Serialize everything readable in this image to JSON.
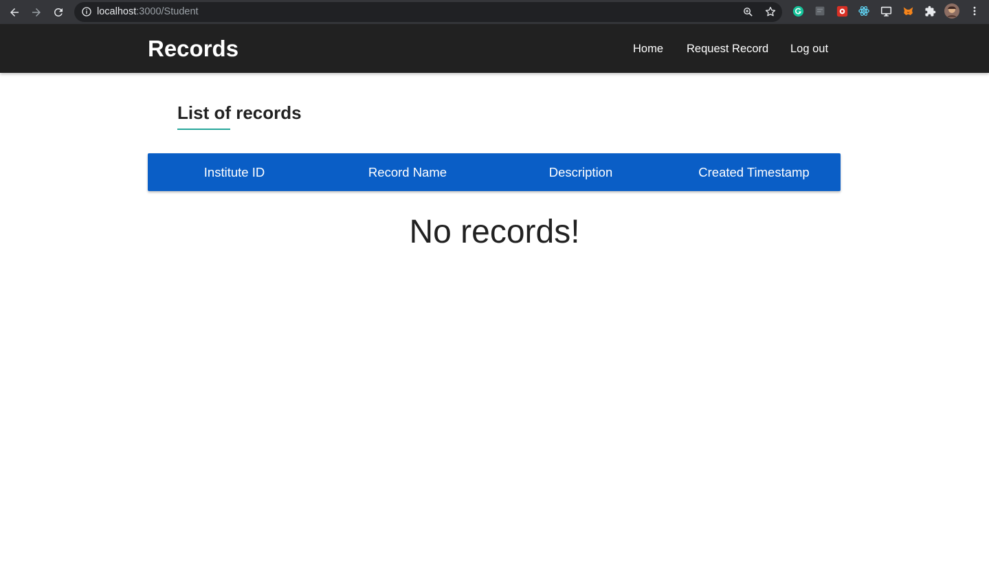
{
  "browser": {
    "url_host": "localhost",
    "url_rest": ":3000/Student",
    "icons": [
      "back-icon",
      "forward-icon",
      "reload-icon",
      "info-icon",
      "zoom-icon",
      "star-icon",
      "grammarly-icon",
      "extension-icon",
      "extension-icon",
      "react-devtools-icon",
      "cast-icon",
      "metamask-icon",
      "puzzle-icon",
      "avatar",
      "menu-icon"
    ]
  },
  "navbar": {
    "brand": "Records",
    "links": [
      "Home",
      "Request Record",
      "Log out"
    ]
  },
  "main": {
    "title": "List of records",
    "table": {
      "columns": [
        "Institute ID",
        "Record Name",
        "Description",
        "Created Timestamp"
      ]
    },
    "empty_message": "No records!"
  },
  "colors": {
    "navbar_bg": "#212121",
    "table_header_bg": "#0a5ec6",
    "title_underline": "#26a69a"
  }
}
